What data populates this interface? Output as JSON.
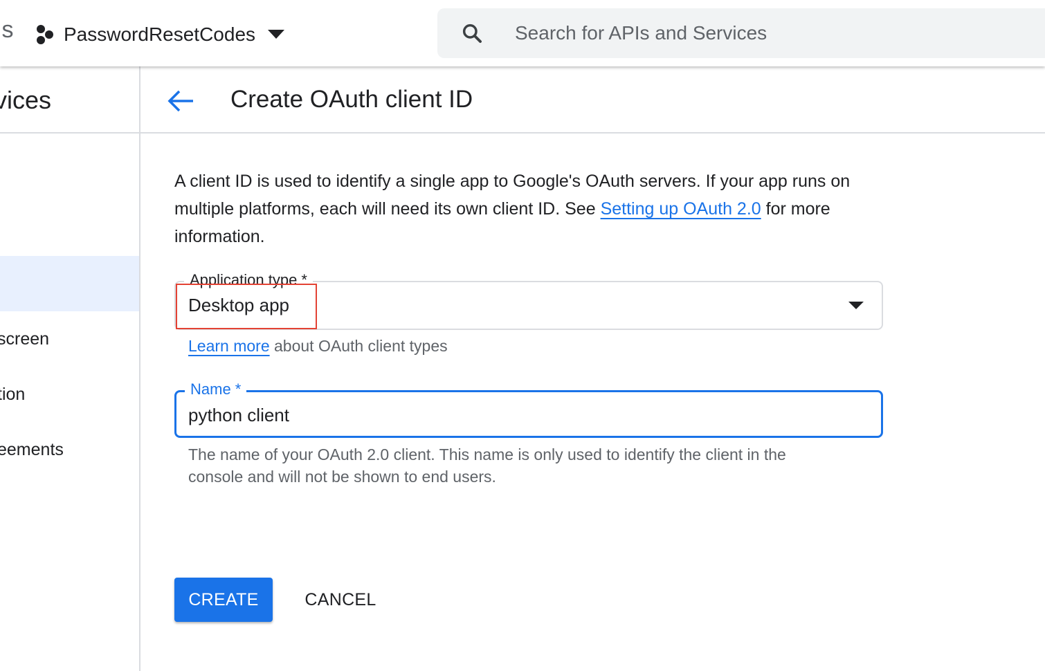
{
  "topbar": {
    "brand_fragment": "ls",
    "project_name": "PasswordResetCodes",
    "search_placeholder": "Search for APIs and Services"
  },
  "sidebar": {
    "title_fragment": "vices",
    "items": [
      {
        "label": ""
      },
      {
        "label": ""
      },
      {
        "label": ""
      },
      {
        "label": "screen"
      },
      {
        "label": "tion"
      },
      {
        "label": "eements"
      }
    ]
  },
  "main": {
    "title": "Create OAuth client ID",
    "intro_before_link": "A client ID is used to identify a single app to Google's OAuth servers. If your app runs on multiple platforms, each will need its own client ID. See ",
    "intro_link": "Setting up OAuth 2.0",
    "intro_after_link": " for more information.",
    "app_type": {
      "label": "Application type *",
      "value": "Desktop app",
      "helper_link": "Learn more",
      "helper_text": " about OAuth client types"
    },
    "name_field": {
      "label": "Name *",
      "value": "python client",
      "hint": "The name of your OAuth 2.0 client. This name is only used to identify the client in the console and will not be shown to end users."
    },
    "create_label": "CREATE",
    "cancel_label": "CANCEL"
  },
  "colors": {
    "accent": "#1a73e8",
    "highlight": "#e34234",
    "active_nav_bg": "#e8f0fe"
  }
}
